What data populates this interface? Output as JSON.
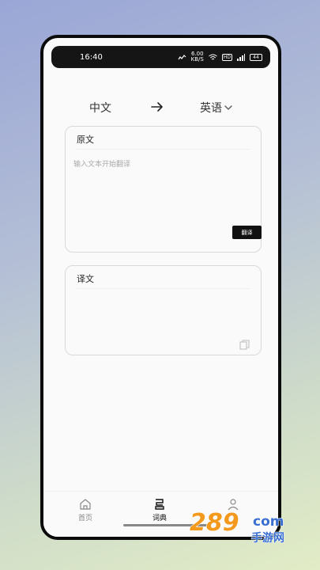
{
  "status_bar": {
    "time": "16:40",
    "net_speed_value": "6.00",
    "net_speed_unit": "KB/S",
    "hd_label": "HD",
    "battery": "44"
  },
  "lang_bar": {
    "source_lang": "中文",
    "target_lang": "英语"
  },
  "source_card": {
    "title": "原文",
    "placeholder": "输入文本开始翻译",
    "value": "",
    "translate_button": "翻译"
  },
  "target_card": {
    "title": "译文",
    "value": ""
  },
  "tab_bar": {
    "tabs": [
      {
        "label": "首页",
        "icon": "home-icon",
        "active": false
      },
      {
        "label": "词典",
        "icon": "dictionary-icon",
        "active": true
      },
      {
        "label": "",
        "icon": "user-icon",
        "active": false
      }
    ]
  },
  "watermark": {
    "brand_number": "289",
    "brand_suffix": "com",
    "brand_tagline": "手游网"
  },
  "colors": {
    "accent_dark": "#111111",
    "background": "#fafafa",
    "watermark_orange": "#f39a1e",
    "watermark_blue": "#3a6fd1"
  }
}
